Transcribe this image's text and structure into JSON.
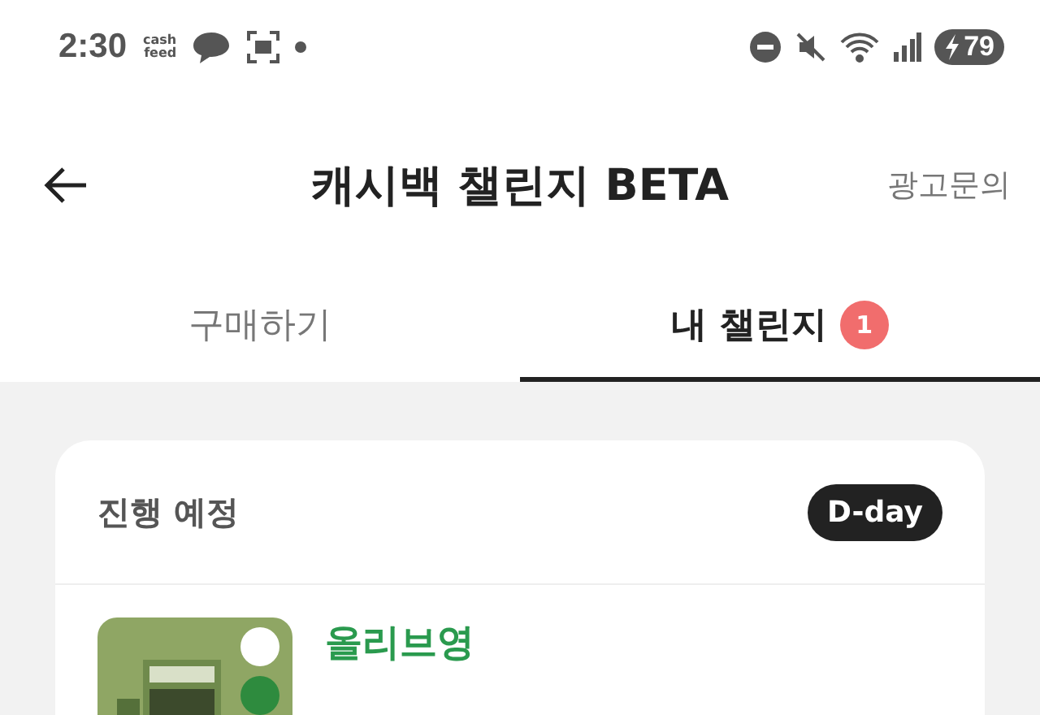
{
  "status_bar": {
    "time": "2:30",
    "app_logo": [
      "cash",
      "feed"
    ],
    "battery": "79"
  },
  "header": {
    "title": "캐시백 챌린지 BETA",
    "action": "광고문의"
  },
  "tabs": [
    {
      "label": "구매하기",
      "selected": false
    },
    {
      "label": "내 챌린지",
      "selected": true,
      "badge": "1"
    }
  ],
  "section": {
    "title": "진행 예정",
    "tag": "D-day"
  },
  "items": [
    {
      "kind": "picture",
      "brand": "올리브영"
    }
  ]
}
